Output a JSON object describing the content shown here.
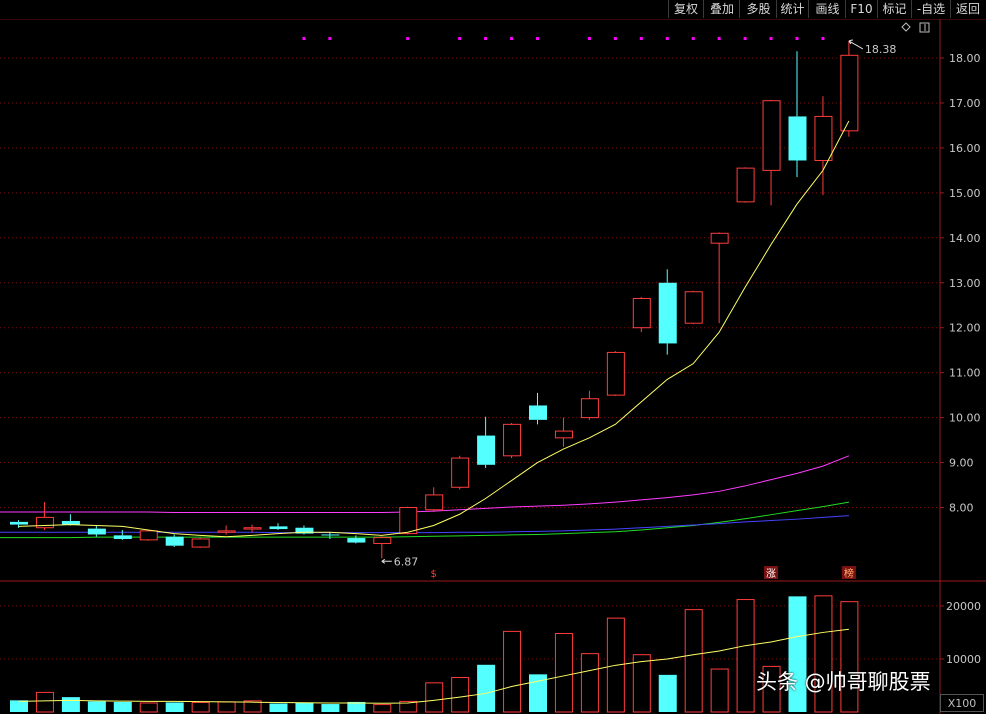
{
  "toolbar": {
    "buttons": [
      {
        "label": "复权"
      },
      {
        "label": "叠加"
      },
      {
        "label": "多股"
      },
      {
        "label": "统计"
      },
      {
        "label": "画线"
      },
      {
        "label": "F10"
      },
      {
        "label": "标记"
      },
      {
        "label": "-自选"
      },
      {
        "label": "返回"
      }
    ]
  },
  "colors": {
    "up": "#ff3c3c",
    "down": "#54ffff",
    "ma5": "#ffff66",
    "ma_magenta": "#ff3cff",
    "ma_green": "#22dd22",
    "ma_blue": "#4444ff",
    "grid": "#7a1010",
    "marker_dot": "#ff00ff"
  },
  "chart_data": [
    {
      "type": "candlestick",
      "y_ticks": [
        "18.00",
        "17.00",
        "16.00",
        "15.00",
        "14.00",
        "13.00",
        "12.00",
        "11.00",
        "10.00",
        "9.00",
        "8.00"
      ],
      "ylim": [
        6.45,
        18.6
      ],
      "annotations": {
        "high_label": "18.38",
        "low_label": "6.87"
      },
      "candles": [
        {
          "o": 7.68,
          "c": 7.62,
          "h": 7.72,
          "l": 7.55
        },
        {
          "o": 7.55,
          "c": 7.78,
          "h": 8.12,
          "l": 7.5
        },
        {
          "o": 7.7,
          "c": 7.62,
          "h": 7.85,
          "l": 7.6
        },
        {
          "o": 7.53,
          "c": 7.4,
          "h": 7.6,
          "l": 7.35
        },
        {
          "o": 7.38,
          "c": 7.3,
          "h": 7.5,
          "l": 7.28
        },
        {
          "o": 7.28,
          "c": 7.48,
          "h": 7.5,
          "l": 7.26
        },
        {
          "o": 7.35,
          "c": 7.15,
          "h": 7.4,
          "l": 7.12
        },
        {
          "o": 7.12,
          "c": 7.3,
          "h": 7.33,
          "l": 7.1
        },
        {
          "o": 7.45,
          "c": 7.48,
          "h": 7.6,
          "l": 7.4
        },
        {
          "o": 7.52,
          "c": 7.55,
          "h": 7.62,
          "l": 7.45
        },
        {
          "o": 7.58,
          "c": 7.52,
          "h": 7.65,
          "l": 7.5
        },
        {
          "o": 7.55,
          "c": 7.42,
          "h": 7.6,
          "l": 7.4
        },
        {
          "o": 7.4,
          "c": 7.38,
          "h": 7.45,
          "l": 7.3
        },
        {
          "o": 7.32,
          "c": 7.22,
          "h": 7.38,
          "l": 7.2
        },
        {
          "o": 7.2,
          "c": 7.33,
          "h": 7.36,
          "l": 6.87
        },
        {
          "o": 7.42,
          "c": 8.0,
          "h": 8.02,
          "l": 7.4
        },
        {
          "o": 7.95,
          "c": 8.28,
          "h": 8.45,
          "l": 7.9
        },
        {
          "o": 8.45,
          "c": 9.1,
          "h": 9.15,
          "l": 8.4
        },
        {
          "o": 9.6,
          "c": 8.95,
          "h": 10.02,
          "l": 8.88
        },
        {
          "o": 9.15,
          "c": 9.85,
          "h": 9.88,
          "l": 9.1
        },
        {
          "o": 10.27,
          "c": 9.95,
          "h": 10.55,
          "l": 9.85
        },
        {
          "o": 9.55,
          "c": 9.7,
          "h": 10.0,
          "l": 9.35
        },
        {
          "o": 10.0,
          "c": 10.42,
          "h": 10.6,
          "l": 9.95
        },
        {
          "o": 10.5,
          "c": 11.45,
          "h": 11.48,
          "l": 10.48
        },
        {
          "o": 12.0,
          "c": 12.65,
          "h": 12.68,
          "l": 11.9
        },
        {
          "o": 13.0,
          "c": 11.65,
          "h": 13.3,
          "l": 11.4
        },
        {
          "o": 12.1,
          "c": 12.8,
          "h": 12.82,
          "l": 12.08
        },
        {
          "o": 13.88,
          "c": 14.1,
          "h": 14.12,
          "l": 12.1
        },
        {
          "o": 14.8,
          "c": 15.55,
          "h": 15.57,
          "l": 14.78
        },
        {
          "o": 15.5,
          "c": 17.05,
          "h": 17.07,
          "l": 14.72
        },
        {
          "o": 16.7,
          "c": 15.72,
          "h": 18.15,
          "l": 15.35
        },
        {
          "o": 15.72,
          "c": 16.7,
          "h": 17.15,
          "l": 14.95
        },
        {
          "o": 16.38,
          "c": 18.06,
          "h": 18.38,
          "l": 16.25
        }
      ],
      "ma5": [
        7.58,
        7.6,
        7.62,
        7.6,
        7.58,
        7.5,
        7.42,
        7.38,
        7.35,
        7.38,
        7.42,
        7.45,
        7.45,
        7.42,
        7.38,
        7.45,
        7.6,
        7.85,
        8.2,
        8.6,
        9.0,
        9.3,
        9.55,
        9.85,
        10.35,
        10.85,
        11.2,
        11.9,
        12.9,
        13.85,
        14.75,
        15.5,
        16.6
      ],
      "ma_magenta": [
        7.9,
        7.9,
        7.9,
        7.9,
        7.9,
        7.9,
        7.89,
        7.89,
        7.89,
        7.89,
        7.89,
        7.89,
        7.89,
        7.89,
        7.89,
        7.9,
        7.92,
        7.95,
        7.98,
        8.01,
        8.03,
        8.05,
        8.08,
        8.12,
        8.17,
        8.22,
        8.28,
        8.36,
        8.48,
        8.62,
        8.76,
        8.92,
        9.15
      ],
      "ma_green": [
        7.33,
        7.33,
        7.33,
        7.34,
        7.34,
        7.34,
        7.34,
        7.34,
        7.34,
        7.34,
        7.34,
        7.34,
        7.34,
        7.34,
        7.34,
        7.35,
        7.36,
        7.37,
        7.38,
        7.39,
        7.4,
        7.42,
        7.44,
        7.46,
        7.5,
        7.55,
        7.6,
        7.67,
        7.75,
        7.84,
        7.93,
        8.02,
        8.12
      ],
      "ma_blue": [
        7.45,
        7.45,
        7.45,
        7.45,
        7.45,
        7.45,
        7.45,
        7.45,
        7.45,
        7.45,
        7.44,
        7.44,
        7.44,
        7.44,
        7.44,
        7.44,
        7.44,
        7.45,
        7.45,
        7.46,
        7.47,
        7.48,
        7.5,
        7.52,
        7.55,
        7.58,
        7.61,
        7.64,
        7.68,
        7.71,
        7.74,
        7.78,
        7.82
      ],
      "bottom_marks": [
        {
          "index": 16,
          "text": "$",
          "color": "#ff3c3c"
        },
        {
          "index": 29,
          "text": "涨",
          "color": "#ffffff",
          "bg": "#7a1010"
        },
        {
          "index": 32,
          "text": "榜",
          "color": "#ffb070",
          "bg": "#7a1010"
        }
      ],
      "top_dot_indices": [
        11,
        12,
        15,
        17,
        18,
        19,
        20,
        22,
        23,
        24,
        25,
        26,
        27,
        28,
        29,
        30,
        31
      ]
    },
    {
      "type": "bar",
      "title": "volume",
      "y_ticks": [
        "20000",
        "10000"
      ],
      "ylim": [
        0,
        23000
      ],
      "values": [
        2200,
        3700,
        2800,
        2000,
        1900,
        1700,
        1800,
        1800,
        1900,
        2100,
        1600,
        1800,
        1500,
        1900,
        1400,
        2000,
        5500,
        6500,
        8900,
        15200,
        7100,
        14800,
        11000,
        17700,
        10800,
        7000,
        19300,
        8100,
        21200,
        8600,
        21800,
        21900,
        20800
      ],
      "ma": [
        2000,
        2100,
        2200,
        2100,
        2050,
        2000,
        2000,
        1950,
        1900,
        1850,
        1800,
        1750,
        1700,
        1700,
        1650,
        1700,
        2200,
        2800,
        3500,
        4800,
        5800,
        6800,
        7800,
        8800,
        9500,
        10000,
        10800,
        11500,
        12500,
        13200,
        14200,
        15000,
        15600
      ]
    }
  ],
  "watermark": {
    "text": "头条 @帅哥聊股票"
  },
  "scale_label": "X100"
}
